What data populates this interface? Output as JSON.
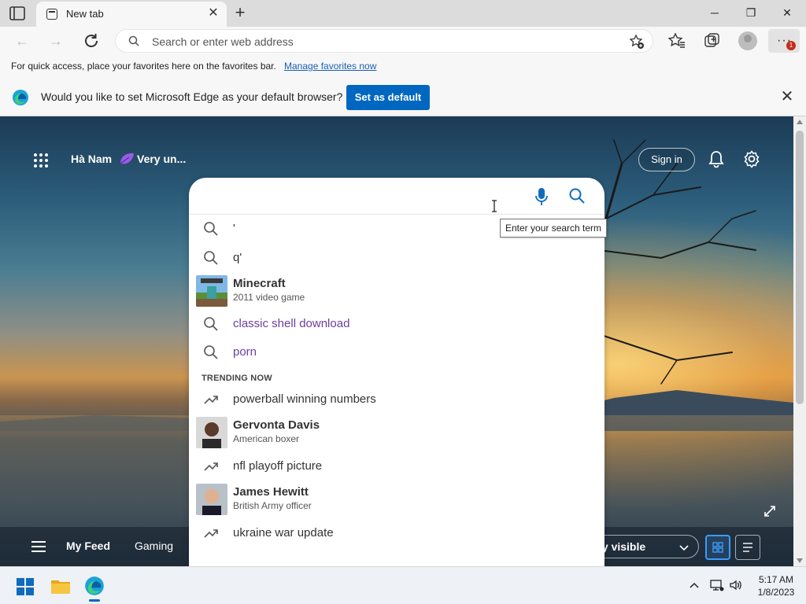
{
  "tab": {
    "title": "New tab"
  },
  "address_bar": {
    "placeholder": "Search or enter web address"
  },
  "toolbar": {
    "notification_count": "1"
  },
  "favorites_bar": {
    "text": "For quick access, place your favorites here on the favorites bar.",
    "link": "Manage favorites now"
  },
  "default_browser_bar": {
    "text": "Would you like to set Microsoft Edge as your default browser?",
    "button": "Set as default"
  },
  "new_tab_page": {
    "location": "Hà Nam",
    "weather": "Very un...",
    "sign_in": "Sign in",
    "feed_tabs": [
      "My Feed",
      "Gaming"
    ],
    "visibility": "ly visible"
  },
  "search": {
    "tooltip": "Enter your search term",
    "suggestions": [
      {
        "text": "'"
      },
      {
        "text": "q'"
      },
      {
        "title": "Minecraft",
        "subtitle": "2011 video game"
      },
      {
        "text": "classic shell download"
      },
      {
        "text": "porn"
      }
    ],
    "trending_header": "TRENDING NOW",
    "trending": [
      {
        "text": "powerball winning numbers"
      },
      {
        "title": "Gervonta Davis",
        "subtitle": "American boxer"
      },
      {
        "text": "nfl playoff picture"
      },
      {
        "title": "James Hewitt",
        "subtitle": "British Army officer"
      },
      {
        "text": "ukraine war update"
      }
    ]
  },
  "taskbar": {
    "time": "5:17 AM",
    "date": "1/8/2023"
  },
  "colors": {
    "accent": "#0067c0",
    "visited": "#6b3fa0"
  }
}
